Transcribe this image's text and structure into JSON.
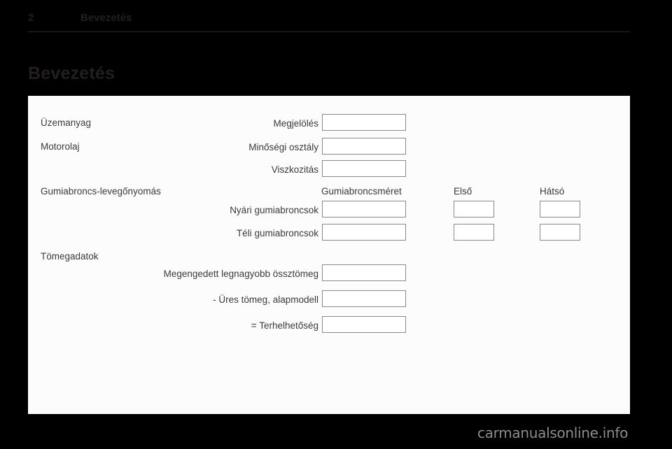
{
  "header": {
    "page_number": "2",
    "chapter": "Bevezetés"
  },
  "chapter_title": "Bevezetés",
  "form": {
    "sections": [
      {
        "name": "fuel",
        "label": "Üzemanyag",
        "rows": [
          {
            "name": "marking",
            "label": "Megjelölés",
            "value": ""
          }
        ]
      },
      {
        "name": "engine-oil",
        "label": "Motorolaj",
        "rows": [
          {
            "name": "quality-class",
            "label": "Minőségi osztály",
            "value": ""
          },
          {
            "name": "viscosity",
            "label": "Viszkozitás",
            "value": ""
          }
        ]
      },
      {
        "name": "tyre-pressure",
        "label": "Gumiabroncs-levegőnyomás",
        "column_headers": {
          "size": "Gumiabroncsméret",
          "front": "Első",
          "rear": "Hátsó"
        },
        "rows": [
          {
            "name": "summer-tyres",
            "label": "Nyári gumiabroncsok",
            "size": "",
            "front": "",
            "rear": ""
          },
          {
            "name": "winter-tyres",
            "label": "Téli gumiabroncsok",
            "size": "",
            "front": "",
            "rear": ""
          }
        ]
      },
      {
        "name": "mass-data",
        "label": "Tömegadatok",
        "rows": [
          {
            "name": "gross-vehicle-weight",
            "label": "Megengedett legnagyobb össztömeg",
            "value": ""
          },
          {
            "name": "kerb-weight-base-model",
            "label": "- Üres tömeg, alapmodell",
            "value": ""
          },
          {
            "name": "payload",
            "label": "= Terhelhetőség",
            "value": ""
          }
        ]
      }
    ]
  },
  "footer": {
    "watermark": "carmanualsonline.info"
  }
}
